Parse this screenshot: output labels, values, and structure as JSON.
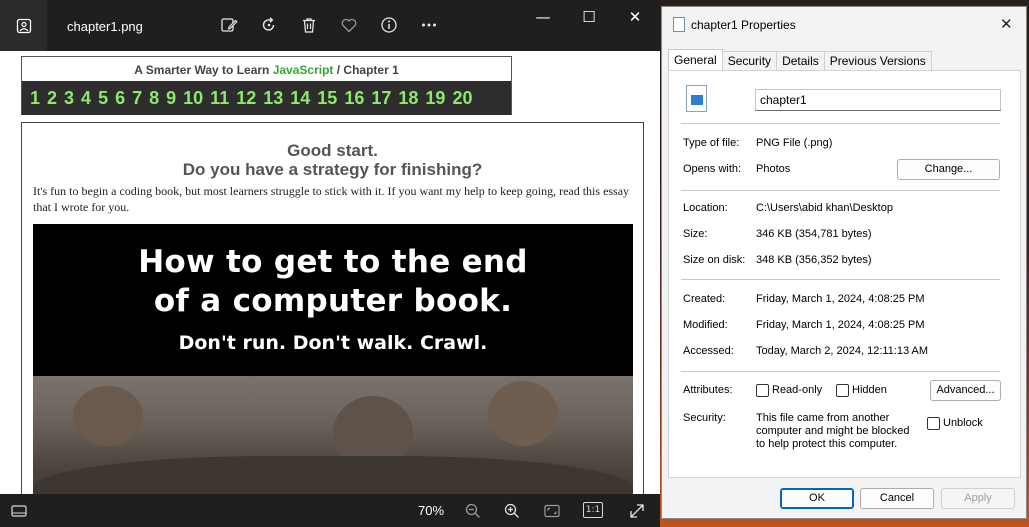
{
  "viewer": {
    "title": "chapter1.png",
    "toolbar_icons": [
      "edit-image-icon",
      "rotate-icon",
      "delete-icon",
      "favorite-icon",
      "info-icon",
      "more-icon"
    ],
    "window_controls": {
      "minimize": "—",
      "maximize": "☐",
      "close": "✕"
    },
    "zoom": "70%",
    "footer_icons": [
      "filmstrip-icon",
      "zoom-out-icon",
      "zoom-in-icon",
      "fit-icon",
      "actual-size-icon",
      "fullscreen-icon"
    ],
    "fit_label": "1:1"
  },
  "book": {
    "header_prefix": "A Smarter Way to Learn ",
    "header_js": "JavaScript",
    "header_suffix": "  /  Chapter 1",
    "chapters": [
      "1",
      "2",
      "3",
      "4",
      "5",
      "6",
      "7",
      "8",
      "9",
      "10",
      "11",
      "12",
      "13",
      "14",
      "15",
      "16",
      "17",
      "18",
      "19",
      "20"
    ],
    "essay_title": "Good start.",
    "essay_subtitle": "Do you have a strategy for finishing?",
    "essay_text": "It's fun to begin a coding book, but most learners struggle to stick with it. If you want my help to keep going, read this essay that I wrote for you.",
    "poster_line1": "How to get to the end",
    "poster_line2": "of a computer book.",
    "poster_line3": "Don't run. Don't walk. Crawl."
  },
  "dialog": {
    "title": "chapter1 Properties",
    "close": "✕",
    "tabs": [
      "General",
      "Security",
      "Details",
      "Previous Versions"
    ],
    "file_name": "chapter1",
    "type_label": "Type of file:",
    "type_value": "PNG File (.png)",
    "opens_label": "Opens with:",
    "opens_value": "Photos",
    "change_button": "Change...",
    "location_label": "Location:",
    "location_value": "C:\\Users\\abid khan\\Desktop",
    "size_label": "Size:",
    "size_value": "346 KB (354,781 bytes)",
    "size_disk_label": "Size on disk:",
    "size_disk_value": "348 KB (356,352 bytes)",
    "created_label": "Created:",
    "created_value": "Friday, March 1, 2024, 4:08:25 PM",
    "modified_label": "Modified:",
    "modified_value": "Friday, March 1, 2024, 4:08:25 PM",
    "accessed_label": "Accessed:",
    "accessed_value": "Today, March 2, 2024, 12:11:13 AM",
    "attributes_label": "Attributes:",
    "readonly_label": "Read-only",
    "hidden_label": "Hidden",
    "advanced_button": "Advanced...",
    "security_label": "Security:",
    "security_text": "This file came from another computer and might be blocked to help protect this computer.",
    "unblock_label": "Unblock",
    "ok_button": "OK",
    "cancel_button": "Cancel",
    "apply_button": "Apply"
  }
}
